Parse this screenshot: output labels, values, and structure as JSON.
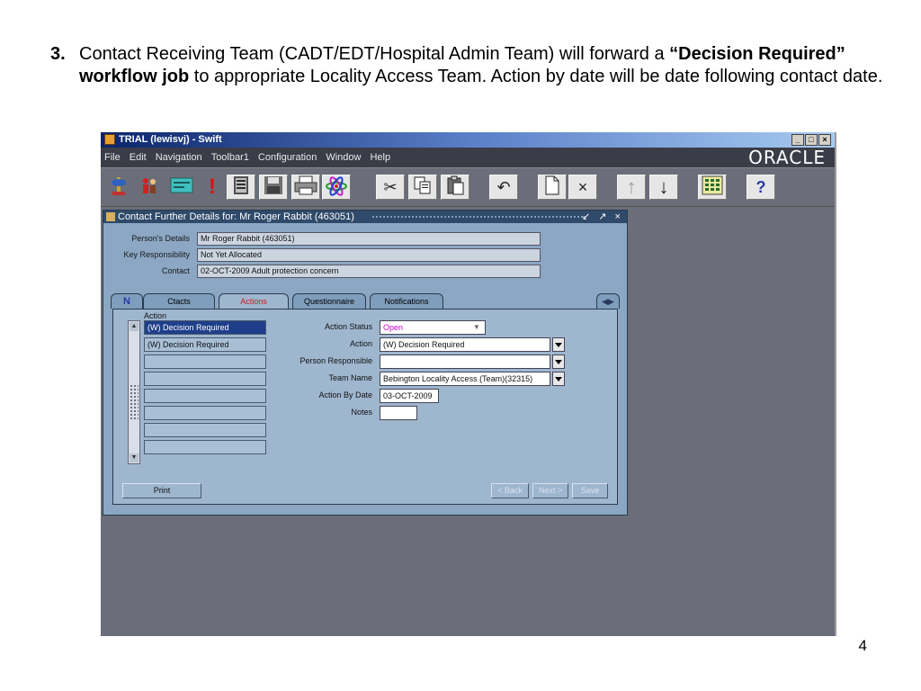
{
  "slide": {
    "step_number": "3.",
    "text_part1": "Contact Receiving Team (CADT/EDT/Hospital Admin Team)   will forward a ",
    "text_bold": "“Decision Required” workflow job",
    "text_part2": " to appropriate Locality Access Team.  Action by date will be date following contact date.",
    "page_number": "4"
  },
  "window": {
    "title": "TRIAL (lewisvj) - Swift",
    "minimize": "_",
    "maximize": "□",
    "close": "×"
  },
  "menu": {
    "items": [
      "File",
      "Edit",
      "Navigation",
      "Toolbar1",
      "Configuration",
      "Window",
      "Help"
    ],
    "brand": "ORACLE"
  },
  "toolbar": {
    "icons": [
      "map-pin-icon",
      "people-icon",
      "card-icon",
      "alert-icon",
      "ledger-icon",
      "save-disk-icon",
      "printer-icon",
      "atom-icon",
      "cut-icon",
      "copy-icon",
      "paste-icon",
      "undo-icon",
      "new-document-icon",
      "delete-icon",
      "upload-icon",
      "download-icon",
      "grid-icon",
      "help-icon"
    ],
    "glyphs": {
      "alert": "!",
      "help": "?",
      "delete": "×",
      "undo": "↶",
      "cut": "✂",
      "upload": "↑",
      "download": "↓"
    }
  },
  "form": {
    "title": "Contact Further Details for:  Mr Roger Rabbit (463051)",
    "title_controls": "↙ ↗ ×",
    "persons_details_label": "Person's Details",
    "persons_details_value": "Mr Roger Rabbit (463051)",
    "key_responsibility_label": "Key Responsibility",
    "key_responsibility_value": "Not Yet Allocated",
    "contact_label": "Contact",
    "contact_value": "02-OCT-2009 Adult protection concern",
    "tabs": [
      {
        "label": "N",
        "active": false
      },
      {
        "label": "Ctacts",
        "active": false
      },
      {
        "label": "Actions",
        "active": true
      },
      {
        "label": "Questionnaire",
        "active": false
      },
      {
        "label": "Notifications",
        "active": false
      }
    ],
    "nav_arrows": "◀▶",
    "action_list_header": "Action",
    "action_list": [
      "(W) Decision Required",
      "(W) Decision Required",
      "",
      "",
      "",
      "",
      "",
      ""
    ],
    "action_status_label": "Action Status",
    "action_status_value": "Open",
    "action_label": "Action",
    "action_value": "(W) Decision Required",
    "person_responsible_label": "Person Responsible",
    "person_responsible_value": "",
    "team_name_label": "Team Name",
    "team_name_value": "Bebington Locality Access (Team)(32315)",
    "action_by_date_label": "Action By Date",
    "action_by_date_value": "03-OCT-2009",
    "notes_label": "Notes",
    "notes_value": "",
    "print_label": "Print",
    "back_label": "< Back",
    "next_label": "Next >",
    "save_label": "Save"
  },
  "colors": {
    "status_open": "#cc00cc",
    "active_tab_text": "#d01818",
    "selected_row": "#1f3f8a"
  }
}
